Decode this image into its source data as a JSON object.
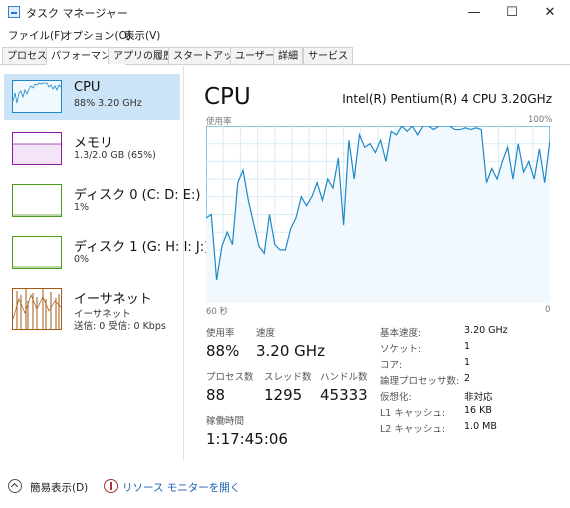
{
  "window": {
    "title": "タスク マネージャー",
    "controls": {
      "minimize": "—",
      "maximize": "☐",
      "close": "✕"
    }
  },
  "menu": [
    "ファイル(F)",
    "オプション(O)",
    "表示(V)"
  ],
  "tabs": [
    "プロセス",
    "パフォーマンス",
    "アプリの履歴",
    "スタートアップ",
    "ユーザー",
    "詳細",
    "サービス"
  ],
  "sidebar": [
    {
      "name": "CPU",
      "sub": "88%  3.20 GHz",
      "sub2": "",
      "color": "#1e88c7",
      "selected": true
    },
    {
      "name": "メモリ",
      "sub": "1.3/2.0 GB (65%)",
      "sub2": "",
      "color": "#8b1aa7"
    },
    {
      "name": "ディスク 0 (C: D: E:)",
      "sub": "1%",
      "sub2": "",
      "color": "#4c9a1a"
    },
    {
      "name": "ディスク 1 (G: H: I: J:)",
      "sub": "0%",
      "sub2": "",
      "color": "#4c9a1a"
    },
    {
      "name": "イーサネット",
      "sub": "イーサネット",
      "sub2": "送信: 0  受信: 0 Kbps",
      "color": "#a25a14"
    }
  ],
  "main": {
    "title": "CPU",
    "model": "Intel(R) Pentium(R) 4 CPU 3.20GHz",
    "usage_axis_label": "使用率",
    "max_label": "100%",
    "time_left": "60 秒",
    "time_right": "0"
  },
  "chart_data": {
    "type": "line",
    "ylim": [
      0,
      100
    ],
    "x_range_seconds": [
      60,
      0
    ],
    "series": [
      {
        "values": [
          48,
          50,
          13,
          32,
          40,
          33,
          68,
          75,
          58,
          45,
          32,
          28,
          50,
          33,
          30,
          30,
          42,
          48,
          60,
          55,
          60,
          68,
          58,
          70,
          65,
          82,
          44,
          92,
          70,
          95,
          88,
          90,
          85,
          92,
          80,
          97,
          95,
          100,
          97,
          100,
          95,
          100,
          100,
          98,
          100,
          100,
          100,
          98,
          98,
          99,
          98,
          99,
          98,
          68,
          76,
          70,
          80,
          88,
          70,
          90,
          74,
          80,
          70,
          87,
          68,
          92
        ]
      }
    ]
  },
  "stats": {
    "utilization_label": "使用率",
    "utilization_value": "88%",
    "speed_label": "速度",
    "speed_value": "3.20 GHz",
    "processes_label": "プロセス数",
    "processes_value": "88",
    "threads_label": "スレッド数",
    "threads_value": "1295",
    "handles_label": "ハンドル数",
    "handles_value": "45333",
    "uptime_label": "稼働時間",
    "uptime_value": "1:17:45:06"
  },
  "specs": [
    {
      "label": "基本速度:",
      "value": "3.20 GHz"
    },
    {
      "label": "ソケット:",
      "value": "1"
    },
    {
      "label": "コア:",
      "value": "1"
    },
    {
      "label": "論理プロセッサ数:",
      "value": "2"
    },
    {
      "label": "仮想化:",
      "value": "非対応"
    },
    {
      "label": "L1 キャッシュ:",
      "value": "16 KB"
    },
    {
      "label": "L2 キャッシュ:",
      "value": "1.0 MB"
    }
  ],
  "footer": {
    "simple_view": "簡易表示(D)",
    "resource_monitor": "リソース モニターを開く"
  },
  "colors": {
    "cpu_line": "#1e88c7",
    "cpu_fill": "#f1f8fe",
    "grid": "#d9ebf7",
    "selected": "#cce4f7"
  }
}
